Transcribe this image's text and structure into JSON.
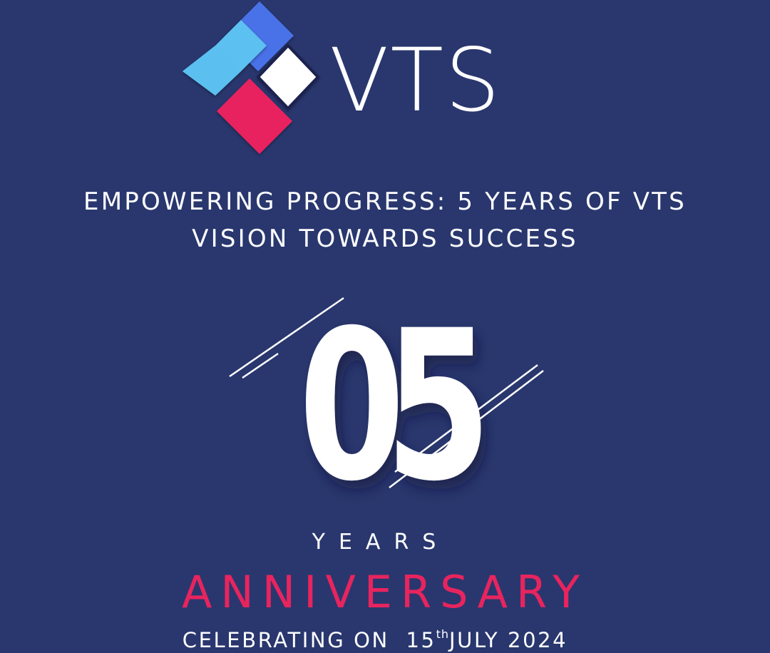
{
  "brand": {
    "wordmark": "VTS",
    "colors": {
      "background": "#29376e",
      "blue": "#4a72e8",
      "cyan": "#5bc0f0",
      "pink": "#e8245e",
      "white": "#ffffff"
    }
  },
  "headline": {
    "line1": "EMPOWERING PROGRESS: 5 YEARS OF VTS",
    "line2": "VISION TOWARDS SUCCESS"
  },
  "milestone": {
    "number": "05",
    "years_label": "YEARS",
    "anniversary_label": "ANNIVERSARY"
  },
  "celebration": {
    "prefix": "CELEBRATING ON",
    "day": "15",
    "day_suffix": "th",
    "month_year": "JULY 2024"
  }
}
